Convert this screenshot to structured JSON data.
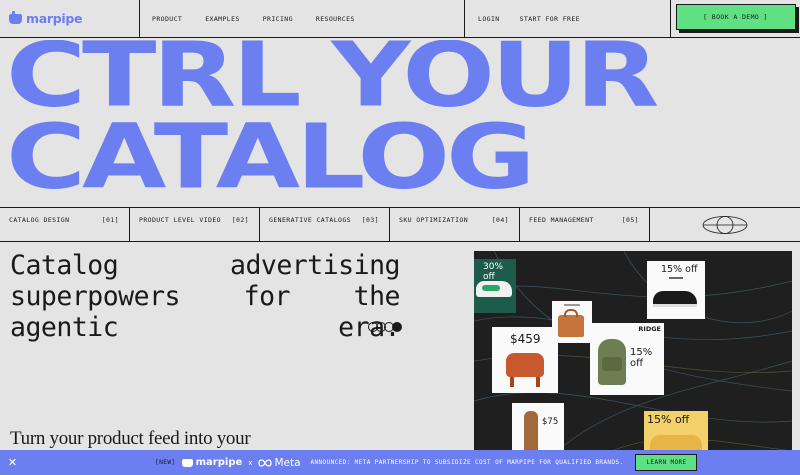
{
  "brand": {
    "name": "marpipe",
    "color": "#6b7ff0"
  },
  "nav": {
    "menu": [
      "PRODUCT",
      "EXAMPLES",
      "PRICING",
      "RESOURCES"
    ],
    "login": "LOGIN",
    "start": "START FOR FREE",
    "cta": "[ BOOK A DEMO ]"
  },
  "hero": {
    "line1": "CTRL YOUR",
    "line2": "CATALOG"
  },
  "features": [
    {
      "title": "CATALOG DESIGN",
      "num": "[01]"
    },
    {
      "title": "PRODUCT LEVEL VIDEO",
      "num": "[02]"
    },
    {
      "title": "GENERATIVE CATALOGS",
      "num": "[03]"
    },
    {
      "title": "SKU OPTIMIZATION",
      "num": "[04]"
    },
    {
      "title": "FEED MANAGEMENT",
      "num": "[05]"
    }
  ],
  "tagline": {
    "line1": "Catalog advertising",
    "line2": "superpowers for the",
    "line3": "agentic era."
  },
  "subhead": "Turn your product feed into your",
  "showcase": {
    "card1_off": "30% off",
    "card2_off": "15% off",
    "price1": "$459",
    "brand_label": "RIDGE",
    "card4_off": "15% off",
    "price2": "$75",
    "card6_off": "15% off"
  },
  "banner": {
    "tag": "[NEW]",
    "logo": "marpipe",
    "x": "x",
    "partner": "Meta",
    "message": "ANNOUNCED: META PARTNERSHIP TO SUBSIDIZE COST OF MARPIPE FOR QUALIFIED BRANDS.",
    "button": "LEARN MORE"
  },
  "icons": [
    "close-icon",
    "globe-icon",
    "meta-infinity-icon",
    "marpipe-logo-icon"
  ],
  "colors": {
    "accent_blue": "#6b7ff0",
    "accent_green": "#5ee083",
    "background": "#e4e4e4",
    "dark": "#1f1f1f"
  }
}
